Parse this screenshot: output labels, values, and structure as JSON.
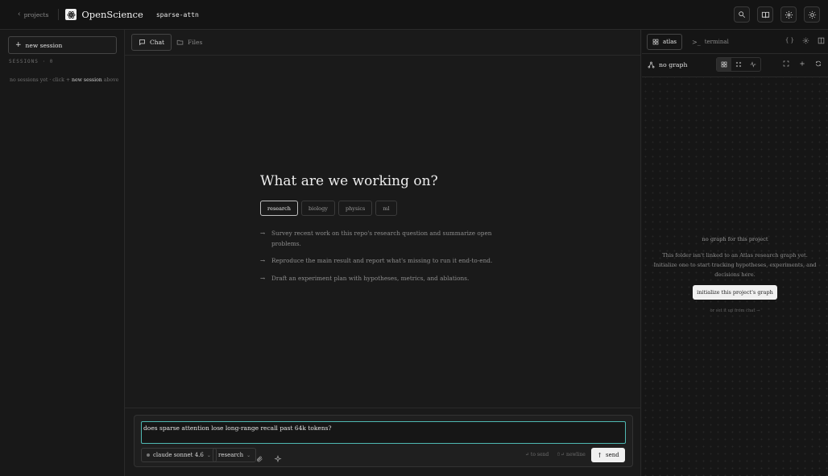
{
  "topbar": {
    "back_label": "projects",
    "brand": "OpenScience",
    "project": "sparse-attn",
    "icons": [
      "search-icon",
      "book-icon",
      "gear-icon",
      "sun-icon"
    ]
  },
  "sidebar": {
    "new_session_label": "new session",
    "sessions_heading": "SESSIONS · 0",
    "empty_prefix": "no sessions yet · click +",
    "empty_emph": "new session",
    "empty_suffix": "above"
  },
  "main": {
    "tabs": [
      {
        "label": "Chat",
        "active": true
      },
      {
        "label": "Files",
        "active": false
      }
    ],
    "hero": "What are we working on?",
    "chips": [
      {
        "label": "research",
        "active": true
      },
      {
        "label": "biology",
        "active": false
      },
      {
        "label": "physics",
        "active": false
      },
      {
        "label": "ml",
        "active": false
      }
    ],
    "suggestions": [
      "Survey recent work on this repo's research question and summarize open problems.",
      "Reproduce the main result and report what's missing to run it end-to-end.",
      "Draft an experiment plan with hypotheses, metrics, and ablations."
    ]
  },
  "composer": {
    "value": "does sparse attention lose long-range recall past 64k tokens?",
    "model": "claude sonnet 4.6",
    "mode": "research",
    "hint_send": "↵ to send",
    "hint_newline": "⇧↵ newline",
    "send_label": "send"
  },
  "right_panel": {
    "tabs": [
      {
        "label": "atlas",
        "active": true
      },
      {
        "label": "terminal",
        "active": false
      }
    ],
    "graph_label": "no graph",
    "empty_title": "no graph for this project",
    "empty_desc": "This folder isn't linked to an Atlas research graph yet. Initialize one to start tracking hypotheses, experiments, and decisions here.",
    "init_button": "initialize this project's graph",
    "or_chat": "or set it up from chat →"
  },
  "colors": {
    "background": "#181818",
    "accent_input_border": "#4fb8b2",
    "primary_button": "#f0f0f0"
  }
}
